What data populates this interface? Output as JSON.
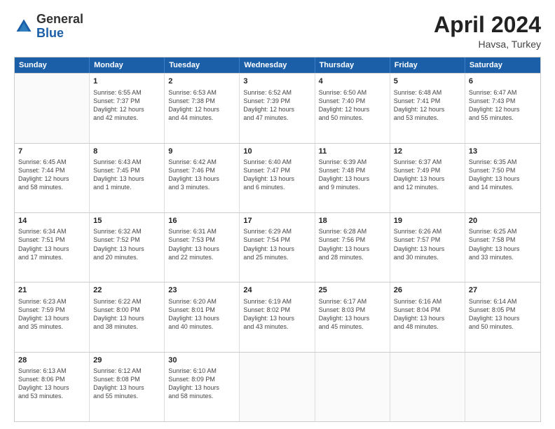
{
  "header": {
    "logo_general": "General",
    "logo_blue": "Blue",
    "main_title": "April 2024",
    "subtitle": "Havsa, Turkey"
  },
  "calendar": {
    "days_of_week": [
      "Sunday",
      "Monday",
      "Tuesday",
      "Wednesday",
      "Thursday",
      "Friday",
      "Saturday"
    ],
    "rows": [
      [
        {
          "day": "",
          "lines": []
        },
        {
          "day": "1",
          "lines": [
            "Sunrise: 6:55 AM",
            "Sunset: 7:37 PM",
            "Daylight: 12 hours",
            "and 42 minutes."
          ]
        },
        {
          "day": "2",
          "lines": [
            "Sunrise: 6:53 AM",
            "Sunset: 7:38 PM",
            "Daylight: 12 hours",
            "and 44 minutes."
          ]
        },
        {
          "day": "3",
          "lines": [
            "Sunrise: 6:52 AM",
            "Sunset: 7:39 PM",
            "Daylight: 12 hours",
            "and 47 minutes."
          ]
        },
        {
          "day": "4",
          "lines": [
            "Sunrise: 6:50 AM",
            "Sunset: 7:40 PM",
            "Daylight: 12 hours",
            "and 50 minutes."
          ]
        },
        {
          "day": "5",
          "lines": [
            "Sunrise: 6:48 AM",
            "Sunset: 7:41 PM",
            "Daylight: 12 hours",
            "and 53 minutes."
          ]
        },
        {
          "day": "6",
          "lines": [
            "Sunrise: 6:47 AM",
            "Sunset: 7:43 PM",
            "Daylight: 12 hours",
            "and 55 minutes."
          ]
        }
      ],
      [
        {
          "day": "7",
          "lines": [
            "Sunrise: 6:45 AM",
            "Sunset: 7:44 PM",
            "Daylight: 12 hours",
            "and 58 minutes."
          ]
        },
        {
          "day": "8",
          "lines": [
            "Sunrise: 6:43 AM",
            "Sunset: 7:45 PM",
            "Daylight: 13 hours",
            "and 1 minute."
          ]
        },
        {
          "day": "9",
          "lines": [
            "Sunrise: 6:42 AM",
            "Sunset: 7:46 PM",
            "Daylight: 13 hours",
            "and 3 minutes."
          ]
        },
        {
          "day": "10",
          "lines": [
            "Sunrise: 6:40 AM",
            "Sunset: 7:47 PM",
            "Daylight: 13 hours",
            "and 6 minutes."
          ]
        },
        {
          "day": "11",
          "lines": [
            "Sunrise: 6:39 AM",
            "Sunset: 7:48 PM",
            "Daylight: 13 hours",
            "and 9 minutes."
          ]
        },
        {
          "day": "12",
          "lines": [
            "Sunrise: 6:37 AM",
            "Sunset: 7:49 PM",
            "Daylight: 13 hours",
            "and 12 minutes."
          ]
        },
        {
          "day": "13",
          "lines": [
            "Sunrise: 6:35 AM",
            "Sunset: 7:50 PM",
            "Daylight: 13 hours",
            "and 14 minutes."
          ]
        }
      ],
      [
        {
          "day": "14",
          "lines": [
            "Sunrise: 6:34 AM",
            "Sunset: 7:51 PM",
            "Daylight: 13 hours",
            "and 17 minutes."
          ]
        },
        {
          "day": "15",
          "lines": [
            "Sunrise: 6:32 AM",
            "Sunset: 7:52 PM",
            "Daylight: 13 hours",
            "and 20 minutes."
          ]
        },
        {
          "day": "16",
          "lines": [
            "Sunrise: 6:31 AM",
            "Sunset: 7:53 PM",
            "Daylight: 13 hours",
            "and 22 minutes."
          ]
        },
        {
          "day": "17",
          "lines": [
            "Sunrise: 6:29 AM",
            "Sunset: 7:54 PM",
            "Daylight: 13 hours",
            "and 25 minutes."
          ]
        },
        {
          "day": "18",
          "lines": [
            "Sunrise: 6:28 AM",
            "Sunset: 7:56 PM",
            "Daylight: 13 hours",
            "and 28 minutes."
          ]
        },
        {
          "day": "19",
          "lines": [
            "Sunrise: 6:26 AM",
            "Sunset: 7:57 PM",
            "Daylight: 13 hours",
            "and 30 minutes."
          ]
        },
        {
          "day": "20",
          "lines": [
            "Sunrise: 6:25 AM",
            "Sunset: 7:58 PM",
            "Daylight: 13 hours",
            "and 33 minutes."
          ]
        }
      ],
      [
        {
          "day": "21",
          "lines": [
            "Sunrise: 6:23 AM",
            "Sunset: 7:59 PM",
            "Daylight: 13 hours",
            "and 35 minutes."
          ]
        },
        {
          "day": "22",
          "lines": [
            "Sunrise: 6:22 AM",
            "Sunset: 8:00 PM",
            "Daylight: 13 hours",
            "and 38 minutes."
          ]
        },
        {
          "day": "23",
          "lines": [
            "Sunrise: 6:20 AM",
            "Sunset: 8:01 PM",
            "Daylight: 13 hours",
            "and 40 minutes."
          ]
        },
        {
          "day": "24",
          "lines": [
            "Sunrise: 6:19 AM",
            "Sunset: 8:02 PM",
            "Daylight: 13 hours",
            "and 43 minutes."
          ]
        },
        {
          "day": "25",
          "lines": [
            "Sunrise: 6:17 AM",
            "Sunset: 8:03 PM",
            "Daylight: 13 hours",
            "and 45 minutes."
          ]
        },
        {
          "day": "26",
          "lines": [
            "Sunrise: 6:16 AM",
            "Sunset: 8:04 PM",
            "Daylight: 13 hours",
            "and 48 minutes."
          ]
        },
        {
          "day": "27",
          "lines": [
            "Sunrise: 6:14 AM",
            "Sunset: 8:05 PM",
            "Daylight: 13 hours",
            "and 50 minutes."
          ]
        }
      ],
      [
        {
          "day": "28",
          "lines": [
            "Sunrise: 6:13 AM",
            "Sunset: 8:06 PM",
            "Daylight: 13 hours",
            "and 53 minutes."
          ]
        },
        {
          "day": "29",
          "lines": [
            "Sunrise: 6:12 AM",
            "Sunset: 8:08 PM",
            "Daylight: 13 hours",
            "and 55 minutes."
          ]
        },
        {
          "day": "30",
          "lines": [
            "Sunrise: 6:10 AM",
            "Sunset: 8:09 PM",
            "Daylight: 13 hours",
            "and 58 minutes."
          ]
        },
        {
          "day": "",
          "lines": []
        },
        {
          "day": "",
          "lines": []
        },
        {
          "day": "",
          "lines": []
        },
        {
          "day": "",
          "lines": []
        }
      ]
    ]
  }
}
